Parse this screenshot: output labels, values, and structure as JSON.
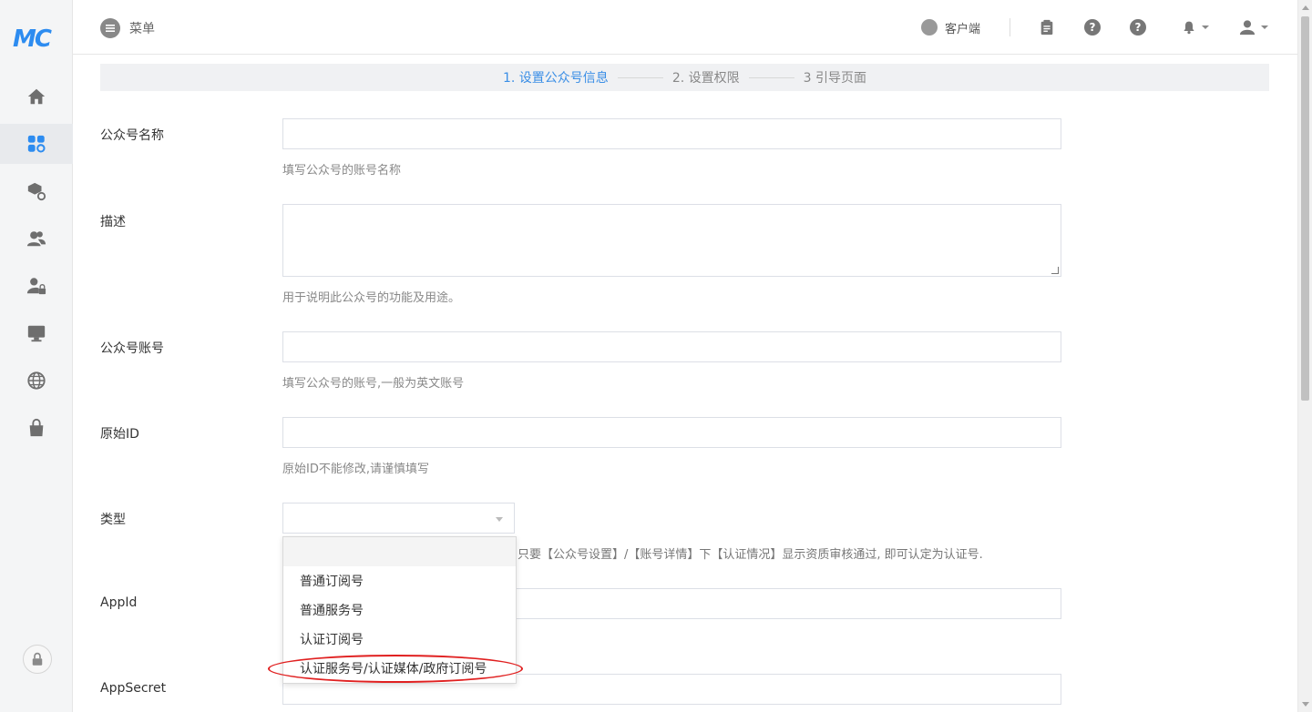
{
  "brand": {
    "logo_text": "MC",
    "accent": "#2d8cf0",
    "active_step_color": "#3a8ee6"
  },
  "sidebar": {
    "items": [
      {
        "icon": "home-icon"
      },
      {
        "icon": "apps-icon",
        "active": true
      },
      {
        "icon": "package-settings-icon"
      },
      {
        "icon": "users-icon"
      },
      {
        "icon": "user-lock-icon"
      },
      {
        "icon": "monitor-icon"
      },
      {
        "icon": "globe-icon"
      },
      {
        "icon": "shopping-bag-icon"
      }
    ],
    "bottom_icon": "lock-icon"
  },
  "header": {
    "menu_label": "菜单",
    "client_label": "客户端",
    "icons": [
      "clipboard-icon",
      "help-icon",
      "help-icon",
      "bell-icon",
      "user-icon"
    ]
  },
  "steps": [
    {
      "label": "1. 设置公众号信息",
      "active": true
    },
    {
      "label": "2. 设置权限",
      "active": false
    },
    {
      "label": "3 引导页面",
      "active": false
    }
  ],
  "form": {
    "name": {
      "label": "公众号名称",
      "value": "",
      "help": "填写公众号的账号名称"
    },
    "description": {
      "label": "描述",
      "value": "",
      "help": "用于说明此公众号的功能及用途。"
    },
    "account": {
      "label": "公众号账号",
      "value": "",
      "help": "填写公众号的账号,一般为英文账号"
    },
    "original_id": {
      "label": "原始ID",
      "value": "",
      "help": "原始ID不能修改,请谨慎填写"
    },
    "type": {
      "label": "类型",
      "value": "",
      "help_visible_part": "只要【公众号设置】/【账号详情】下【认证情况】显示资质审核通过, 即可认定为认证号.",
      "options": [
        "",
        "普通订阅号",
        "普通服务号",
        "认证订阅号",
        "认证服务号/认证媒体/政府订阅号"
      ],
      "highlighted_option": "认证服务号/认证媒体/政府订阅号"
    },
    "app_id": {
      "label": "AppId",
      "value": ""
    },
    "app_secret": {
      "label": "AppSecret",
      "value": ""
    }
  }
}
